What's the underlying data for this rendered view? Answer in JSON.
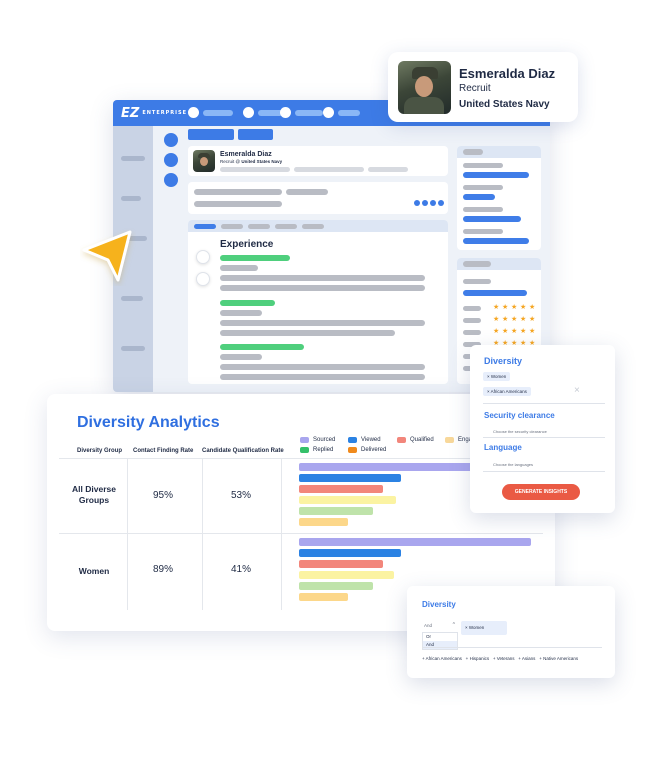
{
  "badge": {
    "name": "Esmeralda Diaz",
    "role": "Recruit",
    "org": "United States Navy"
  },
  "app": {
    "logo": "EZ",
    "logo_sub": "ENTERPRISE",
    "profile_name": "Esmeralda Diaz",
    "profile_role_prefix": "Recruit @ ",
    "profile_org": "United States Navy",
    "experience_title": "Experience"
  },
  "analytics": {
    "title": "Diversity Analytics",
    "columns": [
      "Diversity Group",
      "Contact Finding Rate",
      "Candidate Qualification Rate"
    ],
    "legend": [
      {
        "label": "Sourced",
        "color": "#a9a6ee"
      },
      {
        "label": "Viewed",
        "color": "#2b82e3"
      },
      {
        "label": "Qualified",
        "color": "#f2867b"
      },
      {
        "label": "Engaged",
        "color": "#f8d89a"
      },
      {
        "label": "Replied",
        "color": "#35c06a"
      },
      {
        "label": "Delivered",
        "color": "#f08a1c"
      }
    ],
    "rows": [
      {
        "group": "All Diverse Groups",
        "contact_rate": "95%",
        "qualification_rate": "53%"
      },
      {
        "group": "Women",
        "contact_rate": "89%",
        "qualification_rate": "41%"
      }
    ],
    "bar_colors": [
      "#a9a6ee",
      "#2b82e3",
      "#f2867b",
      "#fbf3a2",
      "#bfe3aa",
      "#fcd78a"
    ],
    "row_bars": [
      [
        0.93,
        0.44,
        0.36,
        0.42,
        0.32,
        0.21
      ],
      [
        1.0,
        0.44,
        0.36,
        0.41,
        0.32,
        0.21
      ]
    ]
  },
  "filter": {
    "diversity_title": "Diversity",
    "diversity_chips": [
      "Women",
      "African Americans"
    ],
    "security_title": "Security clearance",
    "security_placeholder": "Choose the security clearance",
    "language_title": "Language",
    "language_placeholder": "Choose the languages",
    "generate_label": "GENERATE INSIGHTS"
  },
  "bool": {
    "title": "Diversity",
    "operator_value": "And",
    "operator_options": [
      "Or",
      "And"
    ],
    "chip": "Women",
    "options": [
      "African Americans",
      "Hispanics",
      "Veterans",
      "Asians",
      "Native Americans"
    ]
  }
}
